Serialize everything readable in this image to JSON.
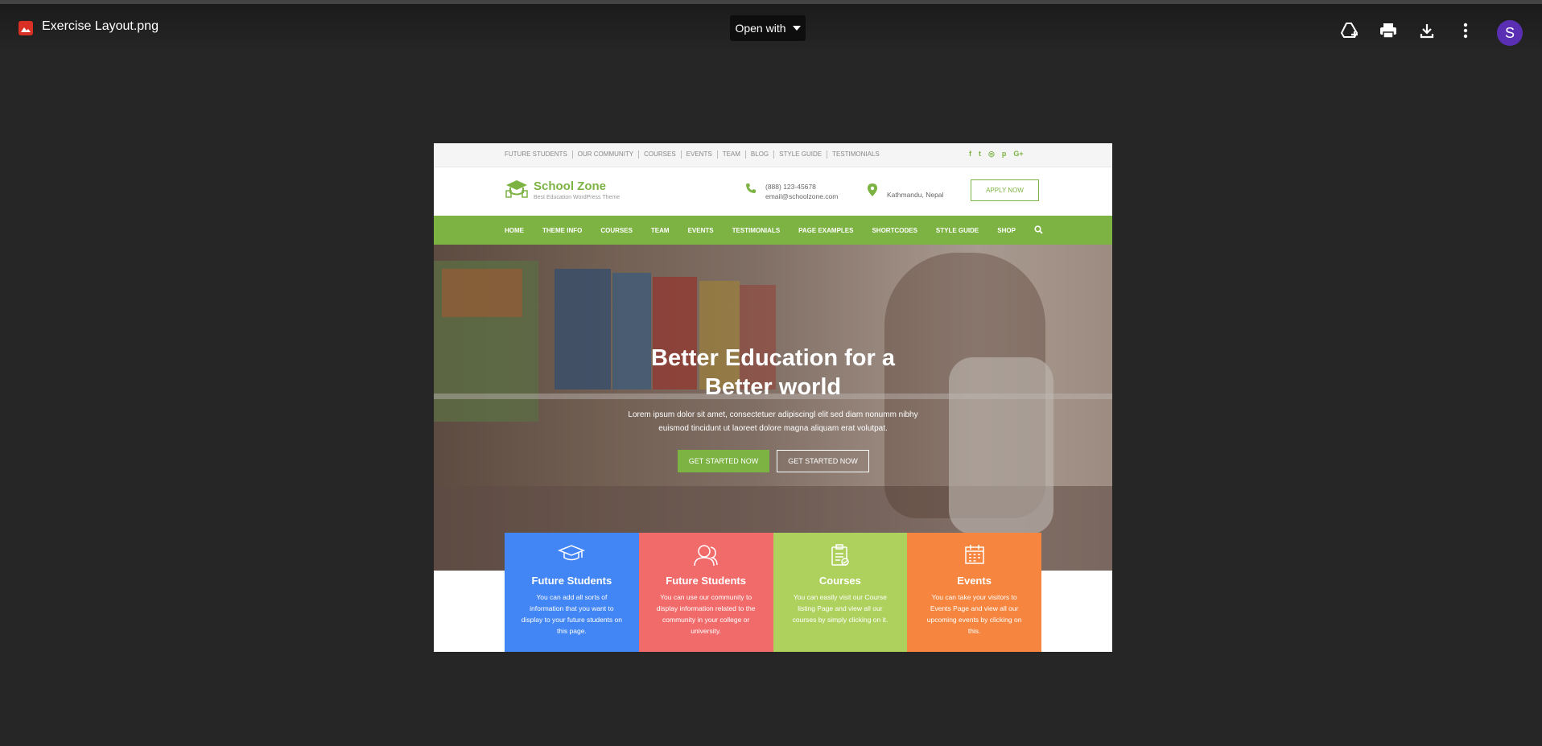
{
  "viewer": {
    "file_name": "Exercise Layout.png",
    "open_with_label": "Open with",
    "avatar_letter": "S"
  },
  "site": {
    "top_links": [
      "FUTURE STUDENTS",
      "OUR COMMUNITY",
      "COURSES",
      "EVENTS",
      "TEAM",
      "BLOG",
      "STYLE GUIDE",
      "TESTIMONIALS"
    ],
    "social_icons": [
      "facebook-icon",
      "twitter-icon",
      "instagram-icon",
      "pinterest-icon",
      "google-plus-icon"
    ],
    "social_glyphs": [
      "f",
      "t",
      "◎",
      "p",
      "G+"
    ],
    "brand_name": "School Zone",
    "brand_tagline": "Best Education WordPress Theme",
    "phone": "(888) 123-45678",
    "email": "email@schoolzone.com",
    "location": "Kathmandu, Nepal",
    "apply_label": "APPLY NOW",
    "nav": [
      "HOME",
      "THEME INFO",
      "COURSES",
      "TEAM",
      "EVENTS",
      "TESTIMONIALS",
      "PAGE EXAMPLES",
      "SHORTCODES",
      "STYLE GUIDE",
      "SHOP"
    ],
    "hero": {
      "title_line1": "Better Education for a",
      "title_line2": "Better world",
      "text_line1": "Lorem ipsum dolor sit amet, consectetuer adipiscingl elit sed diam nonumm nibhy",
      "text_line2": "euismod tincidunt ut laoreet dolore magna aliquam erat volutpat.",
      "primary_cta": "GET STARTED NOW",
      "secondary_cta": "GET STARTED NOW"
    },
    "features": [
      {
        "title": "Future Students",
        "icon": "graduation-cap-icon",
        "color": "#4285f4",
        "desc": "You can add all sorts of information that you want to display to your future students on this page."
      },
      {
        "title": "Future Students",
        "icon": "community-icon",
        "color": "#f26b6b",
        "desc": "You can use our community to display information related to the community in your college or university."
      },
      {
        "title": "Courses",
        "icon": "clipboard-icon",
        "color": "#aed15e",
        "desc": "You can easily visit our Course listing Page and view all our courses by simply clicking on it."
      },
      {
        "title": "Events",
        "icon": "calendar-icon",
        "color": "#f5853f",
        "desc": "You can take your visitors to Events Page and view all our upcoming events by clicking on this."
      }
    ],
    "accent_color": "#7cb342"
  }
}
